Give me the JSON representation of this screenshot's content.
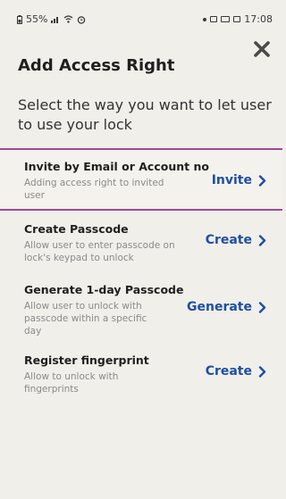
{
  "status_bar": {
    "battery": "55%",
    "time": "17:08",
    "icons": [
      "battery-icon",
      "signal-icon",
      "wifi-icon",
      "alarm-icon",
      "dot-icon",
      "sim-icon",
      "cast-icon",
      "gallery-icon"
    ]
  },
  "header": {
    "title": "Add Access Right",
    "subtitle": "Select the way you want to let user to use your lock"
  },
  "options": [
    {
      "title": "Invite by Email or Account no",
      "description": "Adding access right to invited user",
      "action": "Invite"
    },
    {
      "title": "Create Passcode",
      "description": "Allow user to enter passcode on lock's keypad to unlock",
      "action": "Create"
    },
    {
      "title": "Generate 1-day Passcode",
      "description": "Allow user to unlock with passcode within a specific day",
      "action": "Generate"
    },
    {
      "title": "Register fingerprint",
      "description": "Allow to unlock with fingerprints",
      "action": "Create"
    }
  ],
  "colors": {
    "accent": "#1e4fa3",
    "selection_border": "#9b4b9b",
    "background": "#f1efea"
  }
}
